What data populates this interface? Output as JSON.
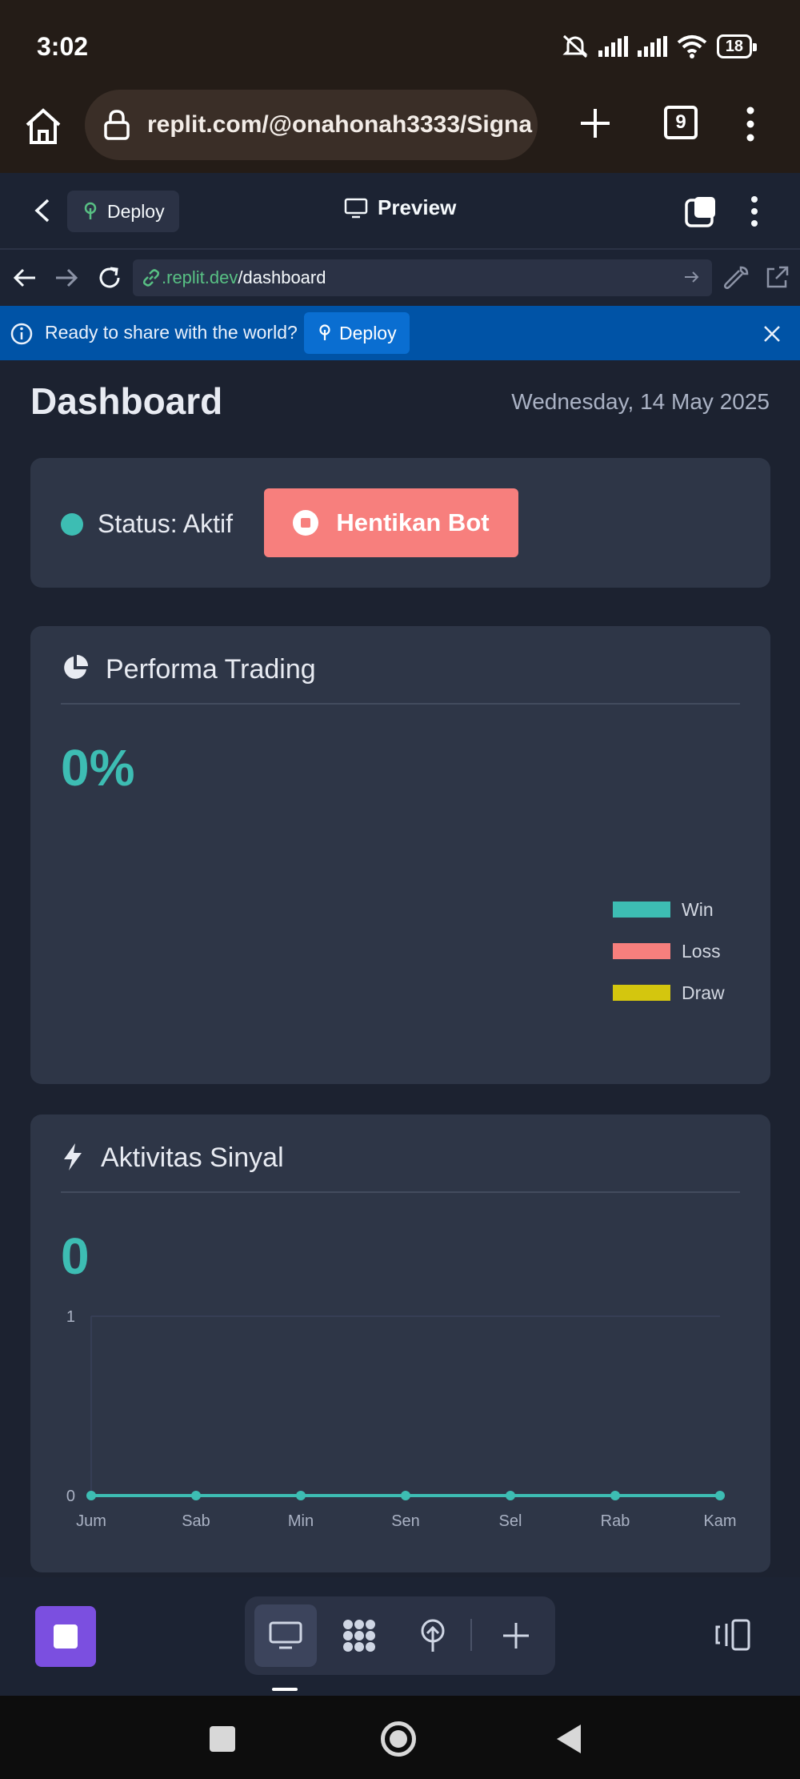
{
  "status_bar": {
    "time": "3:02",
    "battery": "18"
  },
  "browser": {
    "url": "replit.com/@onahonah3333/Signa",
    "tab_count": "9"
  },
  "replit_header": {
    "deploy_label": "Deploy",
    "preview_label": "Preview"
  },
  "webview_nav": {
    "url_domain": ".replit.dev",
    "url_path": "/dashboard"
  },
  "banner": {
    "text": "Ready to share with the world?",
    "deploy_label": "Deploy"
  },
  "dashboard": {
    "title": "Dashboard",
    "date": "Wednesday, 14 May 2025",
    "status_label": "Status: Aktif",
    "stop_button": "Hentikan Bot",
    "performance": {
      "title": "Performa Trading",
      "value": "0%",
      "legend": [
        {
          "label": "Win",
          "color": "#3dbdb3"
        },
        {
          "label": "Loss",
          "color": "#f77f7d"
        },
        {
          "label": "Draw",
          "color": "#d4c60e"
        }
      ]
    },
    "activity": {
      "title": "Aktivitas Sinyal",
      "value": "0"
    }
  },
  "chart_data": {
    "type": "line",
    "title": "",
    "categories": [
      "Jum",
      "Sab",
      "Min",
      "Sen",
      "Sel",
      "Rab",
      "Kam"
    ],
    "series": [
      {
        "values": [
          0,
          0,
          0,
          0,
          0,
          0,
          0
        ],
        "color": "#3dbdb3"
      }
    ],
    "ylim": [
      0,
      1
    ],
    "yticks": [
      "0",
      "1"
    ],
    "grid": true,
    "legend": "none"
  },
  "colors": {
    "accent": "#3dbdb3",
    "danger": "#f77f7d",
    "replit_purple": "#7b4fe0",
    "banner_blue": "#0053a6"
  }
}
